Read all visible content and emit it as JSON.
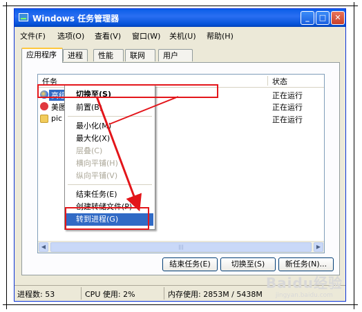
{
  "window": {
    "title": "Windows 任务管理器",
    "controls": {
      "minimize": "_",
      "maximize": "□",
      "close": "✕"
    }
  },
  "menubar": [
    "文件(F)",
    "选项(O)",
    "查看(V)",
    "窗口(W)",
    "关机(U)",
    "帮助(H)"
  ],
  "tabs": [
    "应用程序",
    "进程",
    "性能",
    "联网",
    "用户"
  ],
  "active_tab": "应用程序",
  "list": {
    "columns": [
      "任务",
      "状态"
    ],
    "rows": [
      {
        "name": "高级 搜狗高速浏览器 9.5",
        "status": "正在运行",
        "icon": "browser-icon",
        "selected": true
      },
      {
        "name": "美图",
        "status": "正在运行",
        "icon": "meitu-icon",
        "selected": false
      },
      {
        "name": "pic",
        "status": "正在运行",
        "icon": "folder-icon",
        "selected": false
      }
    ],
    "scroll_grip": "|||"
  },
  "context_menu": {
    "items": [
      "切换至(S)",
      "前置(B)",
      "最小化(M)",
      "最大化(X)",
      "层叠(C)",
      "横向平铺(H)",
      "纵向平铺(V)",
      "结束任务(E)",
      "创建转储文件(P)",
      "转到进程(G)"
    ]
  },
  "buttons": {
    "end_task": "结束任务(E)",
    "switch_to": "切换至(S)",
    "new_task": "新任务(N)..."
  },
  "statusbar": {
    "processes": "进程数: 53",
    "cpu": "CPU 使用: 2%",
    "memory": "内存使用: 2853M / 5438M"
  },
  "watermark": {
    "logo": "Baidu经验",
    "url": "jingyan.baidu.com"
  },
  "colors": {
    "title_bar": "#0a5ee8",
    "highlight": "#316ac5",
    "annotation_red": "#e3151a",
    "dialog_bg": "#ece9d8"
  }
}
